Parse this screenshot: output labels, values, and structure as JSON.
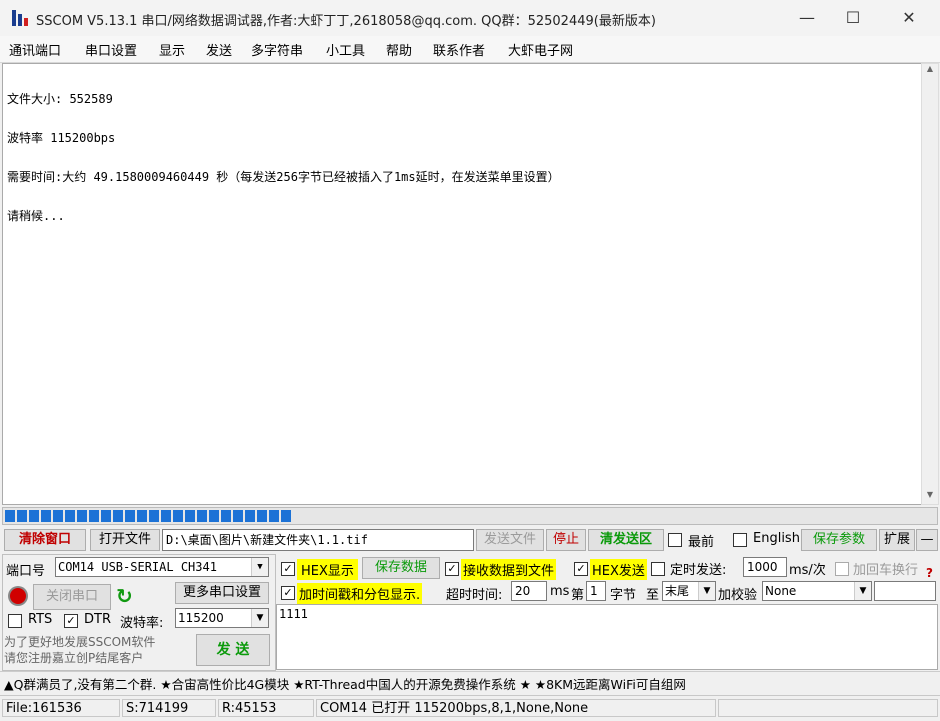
{
  "window": {
    "title": "SSCOM V5.13.1 串口/网络数据调试器,作者:大虾丁丁,2618058@qq.com. QQ群：52502449(最新版本)",
    "minimize": "—",
    "maximize": "☐",
    "close": "✕"
  },
  "menu": [
    "通讯端口",
    "串口设置",
    "显示",
    "发送",
    "多字符串",
    "小工具",
    "帮助",
    "联系作者",
    "大虾电子网"
  ],
  "receive": {
    "lines": [
      "文件大小: 552589",
      "波特率 115200bps",
      "需要时间:大约 49.1580009460449 秒（每发送256字节已经被插入了1ms延时，在发送菜单里设置）",
      "请稍候..."
    ]
  },
  "progress": {
    "fraction": 0.31
  },
  "toolbar": {
    "clear_window": "清除窗口",
    "open_file": "打开文件",
    "file_path": "D:\\桌面\\图片\\新建文件夹\\1.1.tif",
    "send_file": "发送文件",
    "stop": "停止",
    "clear_send": "清发送区",
    "topmost": "最前",
    "english": "English",
    "save_params": "保存参数",
    "expand": "扩展",
    "collapse": "—"
  },
  "port": {
    "port_label": "端口号",
    "port_value": "COM14 USB-SERIAL CH341",
    "more_settings": "更多串口设置",
    "close_port": "关闭串口",
    "rts": "RTS",
    "dtr": "DTR",
    "baud_label": "波特率:",
    "baud_value": "115200",
    "promo_line1": "为了更好地发展SSCOM软件",
    "promo_line2": "请您注册嘉立创P结尾客户",
    "send_button": "发 送"
  },
  "options": {
    "hex_display": "HEX显示",
    "save_data": "保存数据",
    "recv_to_file": "接收数据到文件",
    "hex_send": "HEX发送",
    "timed_send": "定时发送:",
    "timed_value": "1000",
    "timed_unit": "ms/次",
    "add_crlf": "加回车换行",
    "timestamp": "加时间戳和分包显示.",
    "timeout_label": "超时时间:",
    "timeout_value": "20",
    "timeout_unit": "ms",
    "byte_from_label": "第",
    "byte_from_value": "1",
    "byte_label": "字节",
    "to_label": "至",
    "to_value": "末尾",
    "checksum_label": "加校验",
    "checksum_value": "None"
  },
  "send": {
    "content": "1111"
  },
  "marquee": "▲Q群满员了,没有第二个群. ★合宙高性价比4G模块 ★RT-Thread中国人的开源免费操作系统 ★ ★8KM远距离WiFi可自组网",
  "status": {
    "file": "File:161536",
    "sent": "S:714199",
    "recv": "R:45153",
    "port_info": "COM14 已打开  115200bps,8,1,None,None"
  },
  "colors": {
    "accent": "#1c72d6",
    "highlight": "#ffff00",
    "green_text": "#0a9a0a",
    "red_text": "#c00000"
  }
}
